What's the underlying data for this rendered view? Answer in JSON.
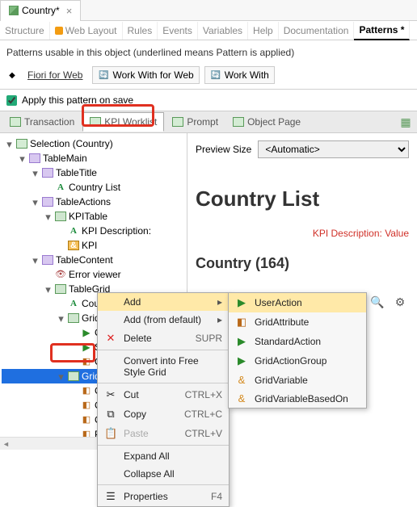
{
  "tab": {
    "title": "Country*",
    "close_tooltip": "Close"
  },
  "subtabs": {
    "structure": "Structure",
    "web_layout": "Web Layout",
    "rules": "Rules",
    "events": "Events",
    "variables": "Variables",
    "help": "Help",
    "documentation": "Documentation",
    "patterns": "Patterns *"
  },
  "info": "Patterns usable in this object (underlined means Pattern is applied)",
  "pattern_buttons": {
    "fiori_web": "Fiori for Web",
    "work_with_web": "Work With for Web",
    "work_with": "Work With"
  },
  "apply_checkbox": "Apply this pattern on save",
  "tool_tabs": {
    "transaction": "Transaction",
    "kpi_worklist": "KPI Worklist",
    "prompt": "Prompt",
    "object_page": "Object Page"
  },
  "tree": {
    "root": "Selection (Country)",
    "table_main": "TableMain",
    "table_title": "TableTitle",
    "country_list": "Country List",
    "table_actions": "TableActions",
    "kpi_table": "KPITable",
    "kpi_desc": "KPI Description:",
    "kpi": "KPI",
    "table_content": "TableContent",
    "error_viewer": "Error viewer",
    "table_grid": "TableGrid",
    "country": "Country",
    "grid_a": "GridA",
    "co1": "Co",
    "st": "St",
    "ch": "Ch",
    "grid": "Grid",
    "co2": "Co",
    "co3": "Co",
    "co4": "Co",
    "pa": "Pa"
  },
  "ctx": {
    "add": "Add",
    "add_default": "Add (from default)",
    "delete": "Delete",
    "delete_key": "SUPR",
    "convert": "Convert into Free Style Grid",
    "cut": "Cut",
    "cut_key": "CTRL+X",
    "copy": "Copy",
    "copy_key": "CTRL+C",
    "paste": "Paste",
    "paste_key": "CTRL+V",
    "expand": "Expand All",
    "collapse": "Collapse All",
    "properties": "Properties",
    "properties_key": "F4"
  },
  "submenu": {
    "user_action": "UserAction",
    "grid_attribute": "GridAttribute",
    "standard_action": "StandardAction",
    "grid_action_group": "GridActionGroup",
    "grid_variable": "GridVariable",
    "grid_var_based": "GridVariableBasedOn"
  },
  "preview": {
    "size_label": "Preview Size",
    "size_value": "<Automatic>",
    "title": "Country List",
    "kpi_text": "KPI Description: Value",
    "subtitle": "Country (164)"
  }
}
